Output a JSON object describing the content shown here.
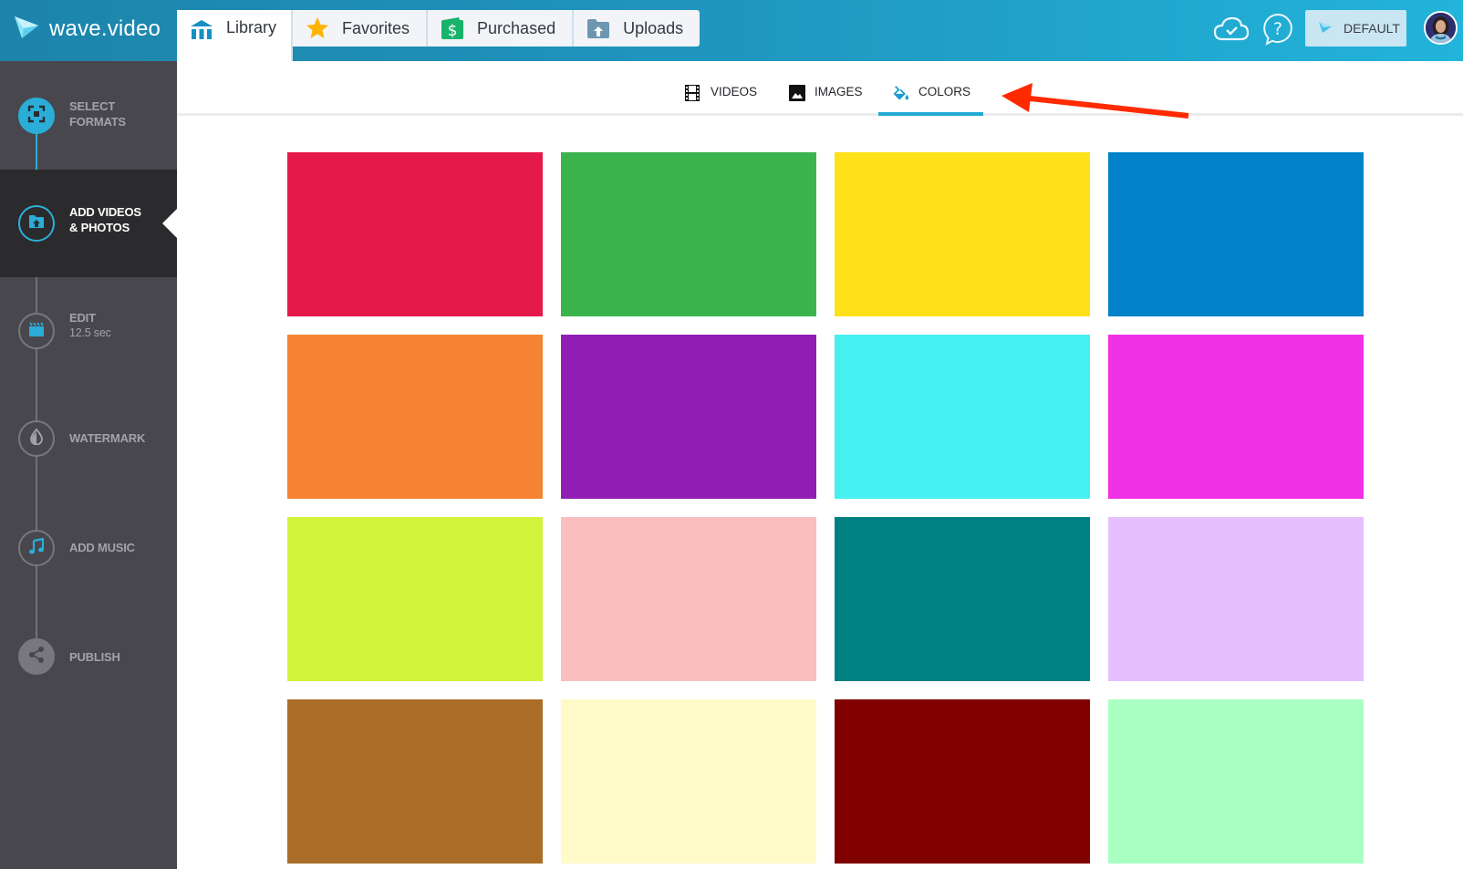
{
  "app": {
    "logo_text": "wave.video"
  },
  "library_tabs": [
    {
      "label": "Library",
      "icon": "library-icon",
      "active": true
    },
    {
      "label": "Favorites",
      "icon": "star-icon",
      "active": false
    },
    {
      "label": "Purchased",
      "icon": "purchased-dollar-icon",
      "active": false
    },
    {
      "label": "Uploads",
      "icon": "upload-folder-icon",
      "active": false
    }
  ],
  "header_right": {
    "cloud_icon": "cloud-check-icon",
    "help_icon": "help-question-icon",
    "brand_button_label": "DEFAULT",
    "avatar": "user-avatar"
  },
  "steps": [
    {
      "label": "SELECT FORMATS",
      "line1": "SELECT",
      "line2": "FORMATS",
      "icon": "select-formats-icon",
      "state": "done"
    },
    {
      "label": "ADD VIDEOS & PHOTOS",
      "line1": "ADD VIDEOS",
      "line2": "& PHOTOS",
      "icon": "folder-upload-icon",
      "state": "active"
    },
    {
      "label": "EDIT",
      "line1": "EDIT",
      "sub": "12.5 sec",
      "icon": "clapperboard-icon",
      "state": "pending"
    },
    {
      "label": "WATERMARK",
      "line1": "WATERMARK",
      "icon": "watermark-drop-icon",
      "state": "pending"
    },
    {
      "label": "ADD MUSIC",
      "line1": "ADD MUSIC",
      "icon": "music-note-icon",
      "state": "pending"
    },
    {
      "label": "PUBLISH",
      "line1": "PUBLISH",
      "icon": "share-icon",
      "state": "pending"
    }
  ],
  "media_tabs": [
    {
      "label": "VIDEOS",
      "icon": "film-icon",
      "active": false
    },
    {
      "label": "IMAGES",
      "icon": "image-icon",
      "active": false
    },
    {
      "label": "COLORS",
      "icon": "paint-bucket-icon",
      "active": true
    }
  ],
  "colors": [
    "#e51a4b",
    "#3cb44e",
    "#ffe119",
    "#0282c8",
    "#f58331",
    "#911eb4",
    "#46f0f0",
    "#f031e6",
    "#d2f53c",
    "#fabebe",
    "#008080",
    "#e6bfff",
    "#aa6e28",
    "#fffac8",
    "#800000",
    "#aaffc3"
  ],
  "theme": {
    "accent": "#22a9d3",
    "sidebar_bg": "#48474d",
    "sidebar_active_bg": "#2b2b2e",
    "annotation_arrow": "#ff2a00"
  }
}
